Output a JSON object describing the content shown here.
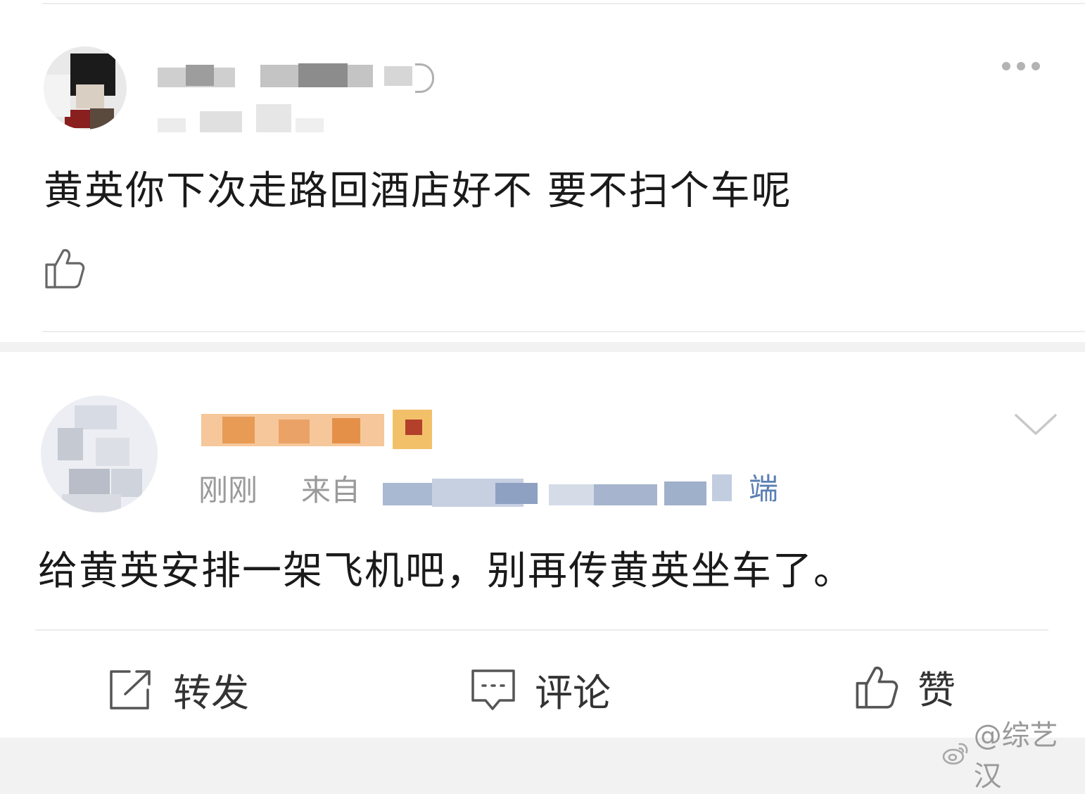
{
  "comment1": {
    "username_blurred": true,
    "text": "黄英你下次走路回酒店好不 要不扫个车呢"
  },
  "comment2": {
    "username_blurred": true,
    "time": "刚刚",
    "from_label": "来自",
    "source_suffix": "端",
    "text": "给黄英安排一架飞机吧，别再传黄英坐车了。"
  },
  "actions": {
    "repost": "转发",
    "comment": "评论",
    "like": "赞"
  },
  "watermark": "@综艺汉",
  "icons": {
    "like": "thumbs-up-icon",
    "more": "more-dots-icon",
    "collapse": "chevron-down-icon",
    "repost": "share-box-icon",
    "comment": "comment-bubble-icon",
    "weibo": "weibo-logo-icon"
  },
  "colors": {
    "source_link": "#5b7fb5",
    "meta_gray": "#9a9a9a"
  }
}
